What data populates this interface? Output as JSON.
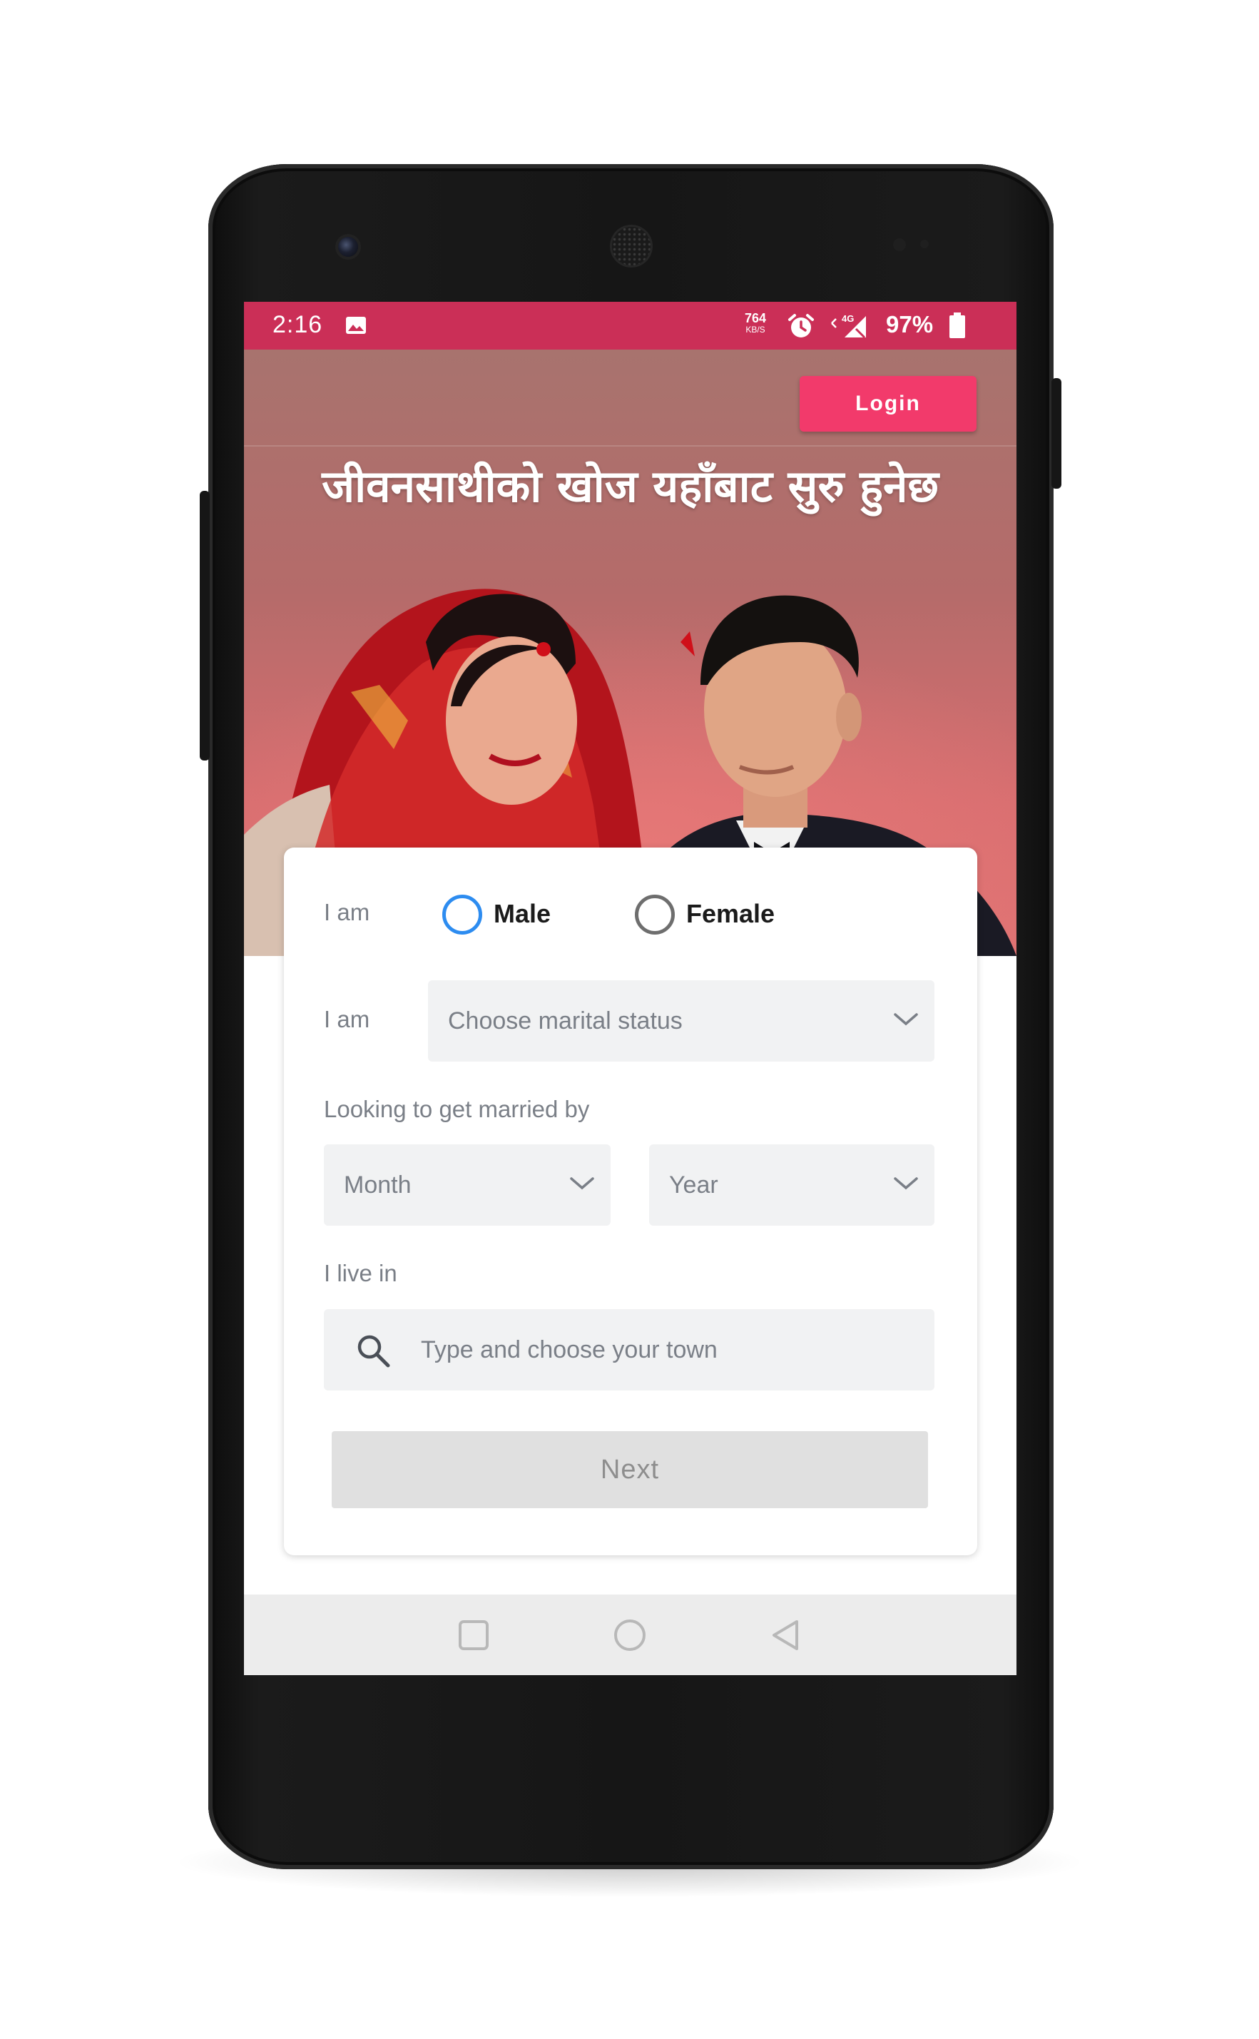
{
  "status_bar": {
    "time": "2:16",
    "net_speed": "764",
    "net_speed_unit": "KB/S",
    "network": "4G",
    "battery_percent": "97%",
    "color": "#cb2f57"
  },
  "header": {
    "login_label": "Login",
    "login_color": "#f23a6b"
  },
  "hero": {
    "title": "जीवनसाथीको खोज यहाँबाट सुरु हुनेछ"
  },
  "form": {
    "gender_label": "I am",
    "gender_options": [
      "Male",
      "Female"
    ],
    "marital_label": "I am",
    "marital_placeholder": "Choose marital status",
    "married_by_label": "Looking to get married by",
    "month_placeholder": "Month",
    "year_placeholder": "Year",
    "live_in_label": "I live in",
    "town_placeholder": "Type and choose your town",
    "next_label": "Next"
  },
  "icons": {
    "status": [
      "image-icon",
      "alarm-icon",
      "signal-4g-icon",
      "battery-icon"
    ],
    "nav": [
      "recent-apps-icon",
      "home-icon",
      "back-icon"
    ]
  }
}
